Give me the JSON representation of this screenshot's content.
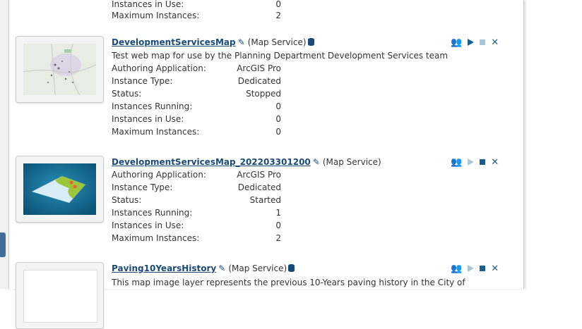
{
  "items": [
    {
      "rows": [
        {
          "label": "Instances in Use:",
          "value": "0"
        },
        {
          "label": "Maximum Instances:",
          "value": "2"
        }
      ]
    },
    {
      "name": "DevelopmentServicesMap",
      "type": "(Map Service)",
      "description": "Test web map for use by the Planning Department Development Services team",
      "rows": [
        {
          "label": "Authoring Application:",
          "value": "ArcGIS Pro"
        },
        {
          "label": "Instance Type:",
          "value": "Dedicated"
        },
        {
          "label": "Status:",
          "value": "Stopped"
        },
        {
          "label": "Instances Running:",
          "value": "0"
        },
        {
          "label": "Instances in Use:",
          "value": "0"
        },
        {
          "label": "Maximum Instances:",
          "value": "0"
        }
      ],
      "start_enabled": true,
      "stop_enabled": false
    },
    {
      "name": "DevelopmentServicesMap_202203301200",
      "type": "(Map Service)",
      "rows": [
        {
          "label": "Authoring Application:",
          "value": "ArcGIS Pro"
        },
        {
          "label": "Instance Type:",
          "value": "Dedicated"
        },
        {
          "label": "Status:",
          "value": "Started"
        },
        {
          "label": "Instances Running:",
          "value": "1"
        },
        {
          "label": "Instances in Use:",
          "value": "0"
        },
        {
          "label": "Maximum Instances:",
          "value": "2"
        }
      ],
      "start_enabled": false,
      "stop_enabled": true
    },
    {
      "name": "Paving10YearsHistory",
      "type": "(Map Service)",
      "description": "This map image layer represents the previous 10-Years paving history in the City of",
      "start_enabled": false,
      "stop_enabled": true
    }
  ],
  "icons": {
    "edit": "pencil-icon",
    "database": "database-icon",
    "permissions": "users-icon",
    "start": "play-icon",
    "stop": "stop-icon",
    "delete": "close-icon"
  },
  "colors": {
    "link": "#1a4a78",
    "action": "#1a5f8c",
    "disabled": "#a8c6d6"
  }
}
